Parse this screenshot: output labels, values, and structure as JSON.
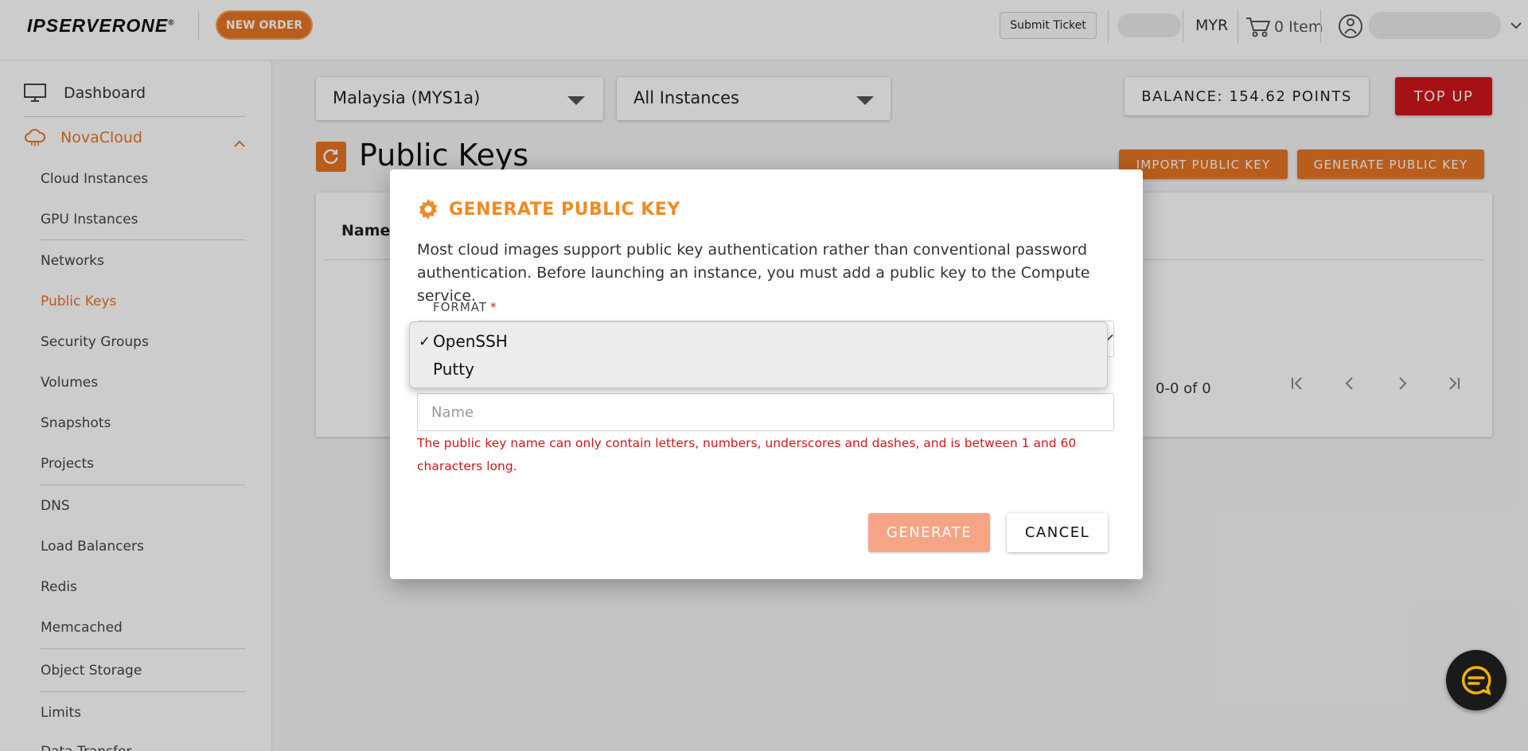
{
  "header": {
    "logo": "IPSERVERONE",
    "logo_mark": "®",
    "new_order": "NEW ORDER",
    "submit_ticket": "Submit Ticket",
    "currency": "MYR",
    "cart_label": "0 Item"
  },
  "sidebar": {
    "dashboard": "Dashboard",
    "section": "NovaCloud",
    "items": [
      {
        "label": "Cloud Instances"
      },
      {
        "label": "GPU Instances"
      },
      {
        "label": "Networks"
      },
      {
        "label": "Public Keys",
        "active": true
      },
      {
        "label": "Security Groups"
      },
      {
        "label": "Volumes"
      },
      {
        "label": "Snapshots"
      },
      {
        "label": "Projects"
      },
      {
        "label": "DNS"
      },
      {
        "label": "Load Balancers"
      },
      {
        "label": "Redis"
      },
      {
        "label": "Memcached"
      },
      {
        "label": "Object Storage"
      },
      {
        "label": "Limits"
      },
      {
        "label": "Data Transfer"
      }
    ]
  },
  "main": {
    "region_select": "Malaysia (MYS1a)",
    "instance_select": "All Instances",
    "balance": "BALANCE: 154.62 POINTS",
    "top_up": "TOP UP",
    "page_title": "Public Keys",
    "import_btn": "IMPORT PUBLIC KEY",
    "generate_btn": "GENERATE PUBLIC KEY",
    "table_header_name": "Name",
    "pagination": "0-0 of 0"
  },
  "modal": {
    "title": "GENERATE PUBLIC KEY",
    "description": "Most cloud images support public key authentication rather than conventional password authentication. Before launching an instance, you must add a public key to the Compute service.",
    "format_label": "FORMAT",
    "required_mark": "*",
    "name_placeholder": "Name",
    "error": "The public key name can only contain letters, numbers, underscores and dashes, and is between 1 and 60 characters long.",
    "generate": "GENERATE",
    "cancel": "CANCEL"
  },
  "dropdown": {
    "options": [
      {
        "label": "OpenSSH",
        "check": "✓",
        "selected": true
      },
      {
        "label": "Putty",
        "check": "",
        "selected": false
      }
    ]
  },
  "colors": {
    "accent": "#e87524",
    "modal_title": "#f08a24",
    "danger": "#d0161b",
    "generate_disabled": "#f5a585"
  }
}
